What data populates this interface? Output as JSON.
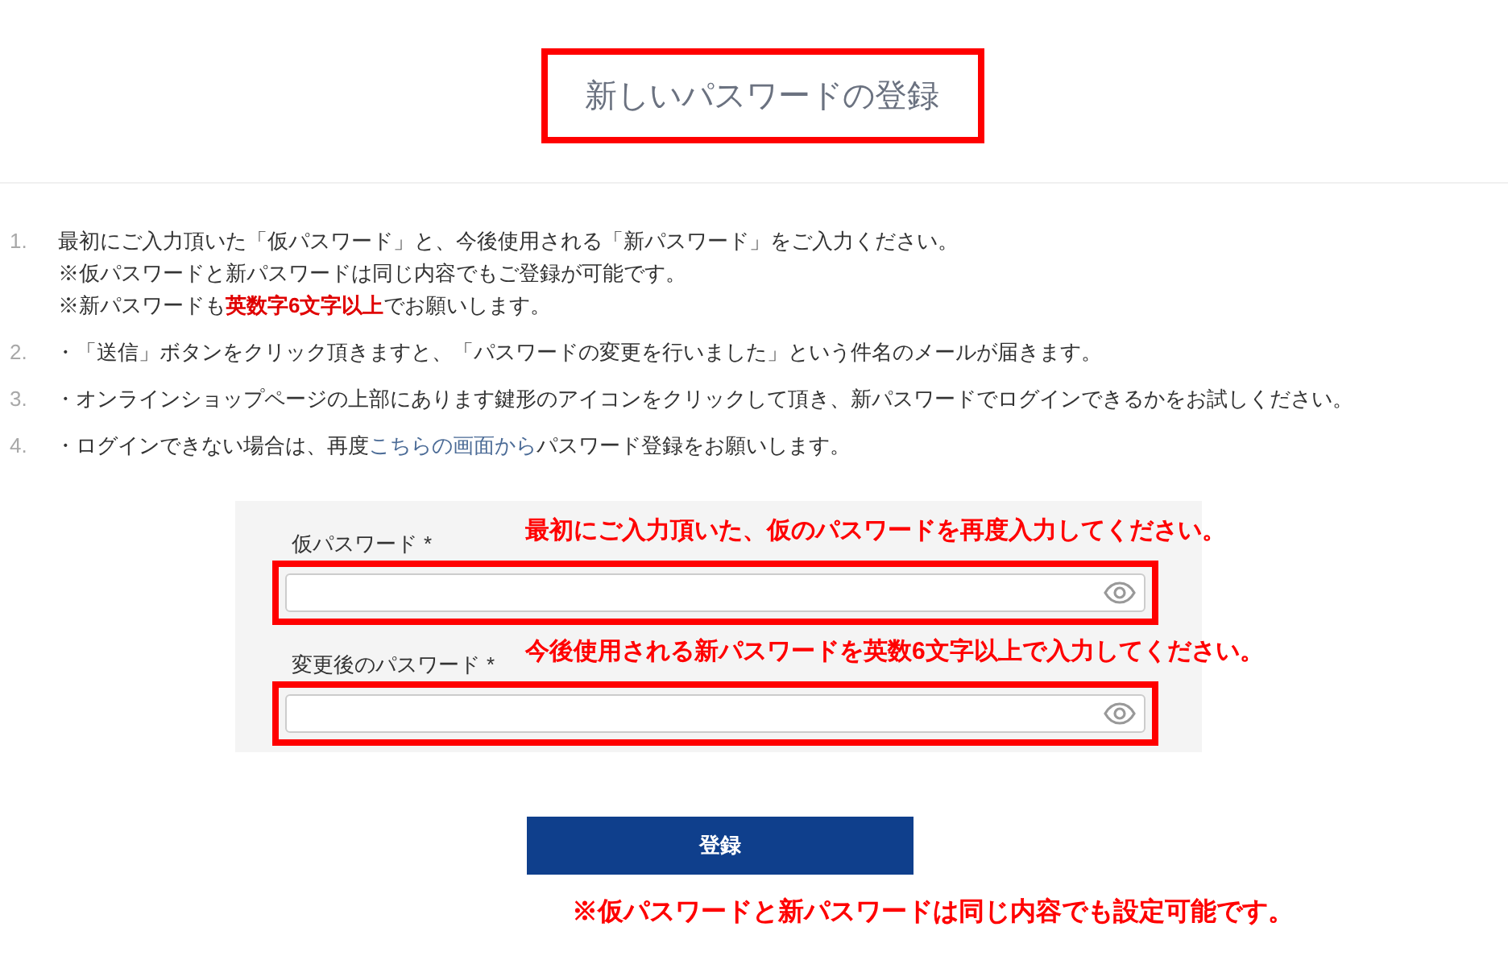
{
  "title": "新しいパスワードの登録",
  "instructions": [
    {
      "number": "1.",
      "lines": [
        "最初にご入力頂いた「仮パスワード」と、今後使用される「新パスワード」をご入力ください。",
        "※仮パスワードと新パスワードは同じ内容でもご登録が可能です。",
        "※新パスワードも**英数字6文字以上**でお願いします。"
      ]
    },
    {
      "number": "2.",
      "lines": [
        "・「送信」ボタンをクリック頂きますと、「パスワードの変更を行いました」という件名のメールが届きます。"
      ]
    },
    {
      "number": "3.",
      "lines": [
        "・オンラインショップページの上部にあります鍵形のアイコンをクリックして頂き、新パスワードでログインできるかをお試しください。"
      ]
    },
    {
      "number": "4.",
      "lines": [
        "・ログインできない場合は、再度"
      ],
      "link": "こちらの画面から",
      "text_after": "パスワード登録をお願いします。"
    }
  ],
  "fields": [
    {
      "label": "仮パスワード",
      "required_mark": "*",
      "annotation": "最初にご入力頂いた、仮のパスワードを再度入力してください。"
    },
    {
      "label": "変更後のパスワード",
      "required_mark": "*",
      "annotation": "今後使用される新パスワードを英数6文字以上で入力してください。"
    }
  ],
  "submit_button": "登録",
  "note": "※仮パスワードと新パスワードは同じ内容でも設定可能です。"
}
